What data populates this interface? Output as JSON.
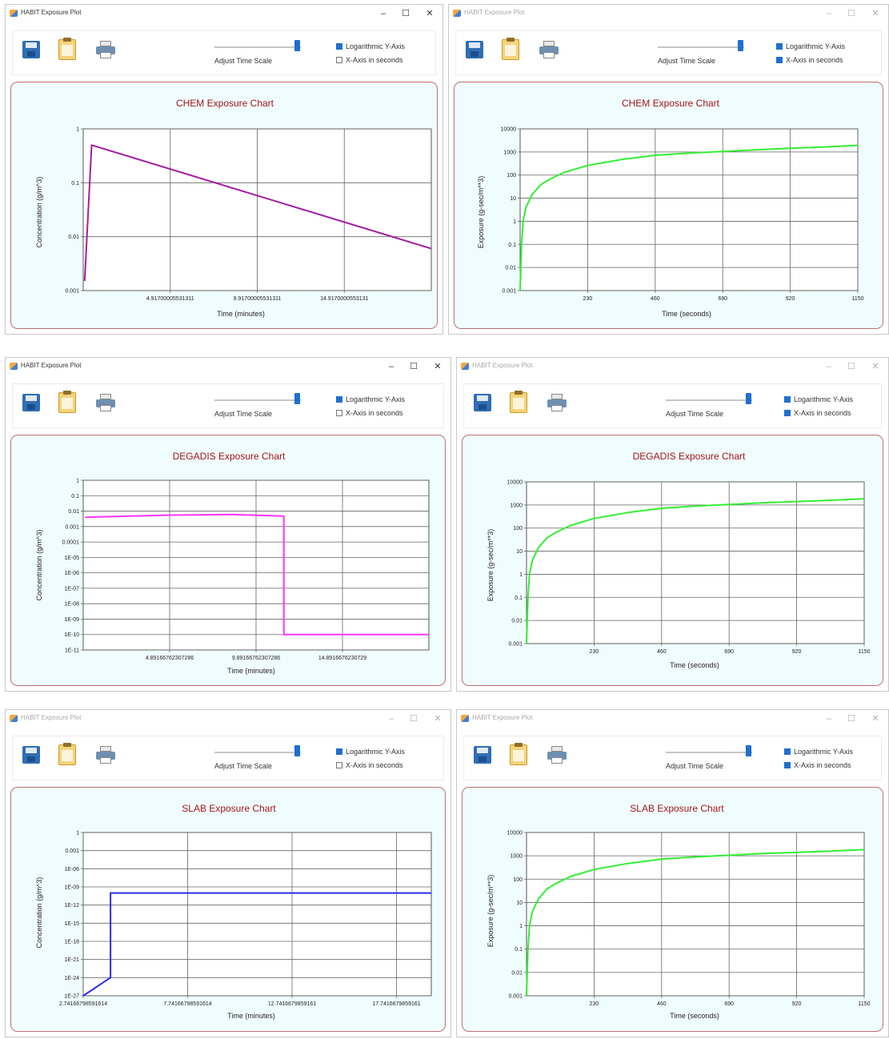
{
  "windows": [
    {
      "id": "w1",
      "active": true,
      "title": "HABIT Exposure Plot",
      "controls": {
        "minimize": "–",
        "maximize": "☐",
        "close": "✕"
      },
      "toolbar": {
        "slider_label": "Adjust Time Scale",
        "slider_value": 1.0,
        "log_y_label": "Logarithmic Y-Axis",
        "log_y_checked": true,
        "x_seconds_label": "X-Axis in seconds",
        "x_seconds_checked": false
      },
      "chart_data": {
        "type": "line",
        "title": "CHEM Exposure Chart",
        "xlabel": "Time (minutes)",
        "ylabel": "Concentration (g/m^3)",
        "xlim": [
          -0.083,
          19.917
        ],
        "ylim": [
          0.001,
          1
        ],
        "y_scale": "log",
        "grid": true,
        "x_ticks": [
          {
            "value": 4.9170000553131,
            "label": "4.91700005531311"
          },
          {
            "value": 9.9170000553131,
            "label": "9.91700005531311"
          },
          {
            "value": 14.9170000553131,
            "label": "14.9170000553131"
          }
        ],
        "y_ticks": [
          {
            "value": 1,
            "label": "1"
          },
          {
            "value": 0.1,
            "label": "0.1"
          },
          {
            "value": 0.01,
            "label": "0.01"
          },
          {
            "value": 0.001,
            "label": "0.001"
          }
        ],
        "series": [
          {
            "color": "#a020a0",
            "points": [
              [
                0.0,
                0.0015
              ],
              [
                0.4,
                0.5
              ],
              [
                19.917,
                0.006
              ]
            ]
          }
        ]
      }
    },
    {
      "id": "w2",
      "active": false,
      "title": "HABIT Exposure Plot",
      "controls": {
        "minimize": "–",
        "maximize": "☐",
        "close": "✕"
      },
      "toolbar": {
        "slider_label": "Adjust Time Scale",
        "slider_value": 1.0,
        "log_y_label": "Logarithmic Y-Axis",
        "log_y_checked": true,
        "x_seconds_label": "X-Axis in seconds",
        "x_seconds_checked": true
      },
      "chart_data": {
        "type": "line",
        "title": "CHEM Exposure Chart",
        "xlabel": "Time (seconds)",
        "ylabel": "Exposure (g-sec/m**3)",
        "xlim": [
          0,
          1150
        ],
        "ylim": [
          0.001,
          10000
        ],
        "y_scale": "log",
        "grid": true,
        "x_ticks": [
          {
            "value": 230,
            "label": "230"
          },
          {
            "value": 460,
            "label": "460"
          },
          {
            "value": 690,
            "label": "690"
          },
          {
            "value": 920,
            "label": "920"
          },
          {
            "value": 1150,
            "label": "1150"
          }
        ],
        "y_ticks": [
          {
            "value": 10000,
            "label": "10000"
          },
          {
            "value": 1000,
            "label": "1000"
          },
          {
            "value": 100,
            "label": "100"
          },
          {
            "value": 10,
            "label": "10"
          },
          {
            "value": 1,
            "label": "1"
          },
          {
            "value": 0.1,
            "label": "0.1"
          },
          {
            "value": 0.01,
            "label": "0.01"
          },
          {
            "value": 0.001,
            "label": "0.001"
          }
        ],
        "series": [
          {
            "color": "#33ee33",
            "points": [
              [
                0,
                0.001
              ],
              [
                5,
                0.1
              ],
              [
                10,
                1
              ],
              [
                20,
                4
              ],
              [
                40,
                14
              ],
              [
                70,
                38
              ],
              [
                100,
                65
              ],
              [
                150,
                130
              ],
              [
                230,
                260
              ],
              [
                345,
                470
              ],
              [
                460,
                720
              ],
              [
                575,
                900
              ],
              [
                690,
                1050
              ],
              [
                805,
                1250
              ],
              [
                920,
                1450
              ],
              [
                1035,
                1650
              ],
              [
                1150,
                1950
              ]
            ]
          }
        ]
      }
    },
    {
      "id": "w3",
      "active": true,
      "title": "HABIT Exposure Plot",
      "controls": {
        "minimize": "–",
        "maximize": "☐",
        "close": "✕"
      },
      "toolbar": {
        "slider_label": "Adjust Time Scale",
        "slider_value": 1.0,
        "log_y_label": "Logarithmic Y-Axis",
        "log_y_checked": true,
        "x_seconds_label": "X-Axis in seconds",
        "x_seconds_checked": false
      },
      "chart_data": {
        "type": "line",
        "title": "DEGADIS Exposure Chart",
        "xlabel": "Time (minutes)",
        "ylabel": "Concentration (g/m^3)",
        "xlim": [
          -0.108,
          19.892
        ],
        "ylim": [
          1e-11,
          1
        ],
        "y_scale": "log",
        "grid": true,
        "x_ticks": [
          {
            "value": 4.8916676230729,
            "label": "4.89166762307286"
          },
          {
            "value": 9.8916676230729,
            "label": "9.89166762307286"
          },
          {
            "value": 14.8916676230729,
            "label": "14.8916676230729"
          }
        ],
        "y_ticks": [
          {
            "value": 1,
            "label": "1"
          },
          {
            "value": 0.1,
            "label": "0.1"
          },
          {
            "value": 0.01,
            "label": "0.01"
          },
          {
            "value": 0.001,
            "label": "0.001"
          },
          {
            "value": 0.0001,
            "label": "0.0001"
          },
          {
            "value": 1e-05,
            "label": "1E-05"
          },
          {
            "value": 1e-06,
            "label": "1E-06"
          },
          {
            "value": 1e-07,
            "label": "1E-07"
          },
          {
            "value": 1e-08,
            "label": "1E-08"
          },
          {
            "value": 1e-09,
            "label": "1E-09"
          },
          {
            "value": 1e-10,
            "label": "1E-10"
          },
          {
            "value": 1e-11,
            "label": "1E-11"
          }
        ],
        "series": [
          {
            "color": "#ff33ff",
            "points": [
              [
                0,
                0.004
              ],
              [
                5,
                0.0055
              ],
              [
                8.5,
                0.006
              ],
              [
                11.5,
                0.0048
              ],
              [
                11.5,
                1e-10
              ],
              [
                19.892,
                1e-10
              ]
            ]
          }
        ]
      }
    },
    {
      "id": "w4",
      "active": false,
      "title": "HABIT Exposure Plot",
      "controls": {
        "minimize": "–",
        "maximize": "☐",
        "close": "✕"
      },
      "toolbar": {
        "slider_label": "Adjust Time Scale",
        "slider_value": 1.0,
        "log_y_label": "Logarithmic Y-Axis",
        "log_y_checked": true,
        "x_seconds_label": "X-Axis in seconds",
        "x_seconds_checked": true
      },
      "chart_data": {
        "type": "line",
        "title": "DEGADIS Exposure Chart",
        "xlabel": "Time (seconds)",
        "ylabel": "Exposure (g-sec/m**3)",
        "xlim": [
          0,
          1150
        ],
        "ylim": [
          0.001,
          10000
        ],
        "y_scale": "log",
        "grid": true,
        "x_ticks": [
          {
            "value": 230,
            "label": "230"
          },
          {
            "value": 460,
            "label": "460"
          },
          {
            "value": 690,
            "label": "690"
          },
          {
            "value": 920,
            "label": "920"
          },
          {
            "value": 1150,
            "label": "1150"
          }
        ],
        "y_ticks": [
          {
            "value": 10000,
            "label": "10000"
          },
          {
            "value": 1000,
            "label": "1000"
          },
          {
            "value": 100,
            "label": "100"
          },
          {
            "value": 10,
            "label": "10"
          },
          {
            "value": 1,
            "label": "1"
          },
          {
            "value": 0.1,
            "label": "0.1"
          },
          {
            "value": 0.01,
            "label": "0.01"
          },
          {
            "value": 0.001,
            "label": "0.001"
          }
        ],
        "series": [
          {
            "color": "#33ee33",
            "points": [
              [
                0,
                0.001
              ],
              [
                5,
                0.1
              ],
              [
                10,
                1
              ],
              [
                20,
                4
              ],
              [
                40,
                14
              ],
              [
                70,
                38
              ],
              [
                100,
                65
              ],
              [
                150,
                130
              ],
              [
                230,
                260
              ],
              [
                345,
                470
              ],
              [
                460,
                720
              ],
              [
                575,
                900
              ],
              [
                690,
                1050
              ],
              [
                805,
                1250
              ],
              [
                920,
                1400
              ],
              [
                1035,
                1600
              ],
              [
                1150,
                1850
              ]
            ]
          }
        ]
      }
    },
    {
      "id": "w5",
      "active": false,
      "title": "HABIT Exposure Plot",
      "controls": {
        "minimize": "–",
        "maximize": "☐",
        "close": "✕"
      },
      "toolbar": {
        "slider_label": "Adjust Time Scale",
        "slider_value": 1.0,
        "log_y_label": "Logarithmic Y-Axis",
        "log_y_checked": true,
        "x_seconds_label": "X-Axis in seconds",
        "x_seconds_checked": false
      },
      "chart_data": {
        "type": "line",
        "title": "SLAB Exposure Chart",
        "xlabel": "Time (minutes)",
        "ylabel": "Concentration (g/m^3)",
        "xlim": [
          2.7416679859161,
          19.4083346525828
        ],
        "ylim": [
          1e-27,
          1
        ],
        "y_scale": "log",
        "grid": true,
        "x_ticks": [
          {
            "value": 2.7416679859161,
            "label": "2.74166798591614"
          },
          {
            "value": 7.7416679859161,
            "label": "7.74166798591614"
          },
          {
            "value": 12.7416679859161,
            "label": "12.7416679859161"
          },
          {
            "value": 17.7416679859161,
            "label": "17.7416679859161"
          }
        ],
        "y_ticks": [
          {
            "value": 1,
            "label": "1"
          },
          {
            "value": 0.001,
            "label": "0.001"
          },
          {
            "value": 1e-06,
            "label": "1E-06"
          },
          {
            "value": 1e-09,
            "label": "1E-09"
          },
          {
            "value": 1e-12,
            "label": "1E-12"
          },
          {
            "value": 1e-15,
            "label": "1E-15"
          },
          {
            "value": 1e-18,
            "label": "1E-18"
          },
          {
            "value": 1e-21,
            "label": "1E-21"
          },
          {
            "value": 1e-24,
            "label": "1E-24"
          },
          {
            "value": 1e-27,
            "label": "1E-27"
          }
        ],
        "series": [
          {
            "color": "#2b2bee",
            "points": [
              [
                2.7416679859161,
                1e-27
              ],
              [
                4.05,
                1e-24
              ],
              [
                4.05,
                1e-10
              ],
              [
                19.4083346525828,
                1e-10
              ]
            ]
          }
        ]
      }
    },
    {
      "id": "w6",
      "active": false,
      "title": "HABIT Exposure Plot",
      "controls": {
        "minimize": "–",
        "maximize": "☐",
        "close": "✕"
      },
      "toolbar": {
        "slider_label": "Adjust Time Scale",
        "slider_value": 1.0,
        "log_y_label": "Logarithmic Y-Axis",
        "log_y_checked": true,
        "x_seconds_label": "X-Axis in seconds",
        "x_seconds_checked": true
      },
      "chart_data": {
        "type": "line",
        "title": "SLAB Exposure Chart",
        "xlabel": "Time (seconds)",
        "ylabel": "Exposure (g-sec/m**3)",
        "xlim": [
          0,
          1150
        ],
        "ylim": [
          0.001,
          10000
        ],
        "y_scale": "log",
        "grid": true,
        "x_ticks": [
          {
            "value": 230,
            "label": "230"
          },
          {
            "value": 460,
            "label": "460"
          },
          {
            "value": 690,
            "label": "690"
          },
          {
            "value": 920,
            "label": "920"
          },
          {
            "value": 1150,
            "label": "1150"
          }
        ],
        "y_ticks": [
          {
            "value": 10000,
            "label": "10000"
          },
          {
            "value": 1000,
            "label": "1000"
          },
          {
            "value": 100,
            "label": "100"
          },
          {
            "value": 10,
            "label": "10"
          },
          {
            "value": 1,
            "label": "1"
          },
          {
            "value": 0.1,
            "label": "0.1"
          },
          {
            "value": 0.01,
            "label": "0.01"
          },
          {
            "value": 0.001,
            "label": "0.001"
          }
        ],
        "series": [
          {
            "color": "#33ee33",
            "points": [
              [
                0,
                0.001
              ],
              [
                5,
                0.1
              ],
              [
                10,
                1
              ],
              [
                20,
                4
              ],
              [
                40,
                14
              ],
              [
                70,
                38
              ],
              [
                100,
                65
              ],
              [
                150,
                130
              ],
              [
                230,
                260
              ],
              [
                345,
                470
              ],
              [
                460,
                720
              ],
              [
                575,
                900
              ],
              [
                690,
                1050
              ],
              [
                805,
                1250
              ],
              [
                920,
                1400
              ],
              [
                1035,
                1600
              ],
              [
                1150,
                1850
              ]
            ]
          }
        ]
      }
    }
  ]
}
